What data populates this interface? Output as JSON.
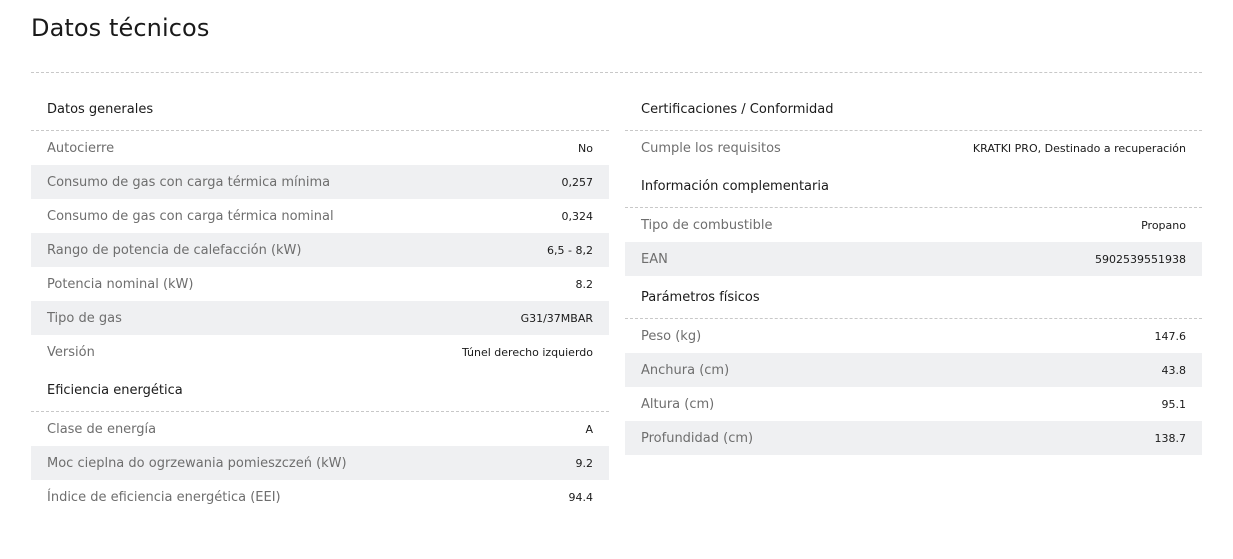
{
  "page": {
    "title": "Datos técnicos"
  },
  "left": {
    "general": {
      "heading": "Datos generales",
      "rows": [
        {
          "label": "Autocierre",
          "value": "No"
        },
        {
          "label": "Consumo de gas con carga térmica mínima",
          "value": "0,257"
        },
        {
          "label": "Consumo de gas con carga térmica nominal",
          "value": "0,324"
        },
        {
          "label": "Rango de potencia de calefacción (kW)",
          "value": "6,5 - 8,2"
        },
        {
          "label": "Potencia nominal (kW)",
          "value": "8.2"
        },
        {
          "label": "Tipo de gas",
          "value": "G31/37MBAR"
        },
        {
          "label": "Versión",
          "value": "Túnel derecho izquierdo"
        }
      ]
    },
    "energy": {
      "heading": "Eficiencia energética",
      "rows": [
        {
          "label": "Clase de energía",
          "value": "A"
        },
        {
          "label": "Moc cieplna do ogrzewania pomieszczeń (kW)",
          "value": "9.2"
        },
        {
          "label": "Índice de eficiencia energética (EEI)",
          "value": "94.4"
        }
      ]
    }
  },
  "right": {
    "certifications": {
      "heading": "Certificaciones / Conformidad",
      "rows": [
        {
          "label": "Cumple los requisitos",
          "value": "KRATKI PRO, Destinado a recuperación"
        }
      ]
    },
    "complementary": {
      "heading": "Información complementaria",
      "rows": [
        {
          "label": "Tipo de combustible",
          "value": "Propano"
        },
        {
          "label": "EAN",
          "value": "5902539551938"
        }
      ]
    },
    "physical": {
      "heading": "Parámetros físicos",
      "rows": [
        {
          "label": "Peso (kg)",
          "value": "147.6"
        },
        {
          "label": "Anchura (cm)",
          "value": "43.8"
        },
        {
          "label": "Altura (cm)",
          "value": "95.1"
        },
        {
          "label": "Profundidad (cm)",
          "value": "138.7"
        }
      ]
    }
  }
}
